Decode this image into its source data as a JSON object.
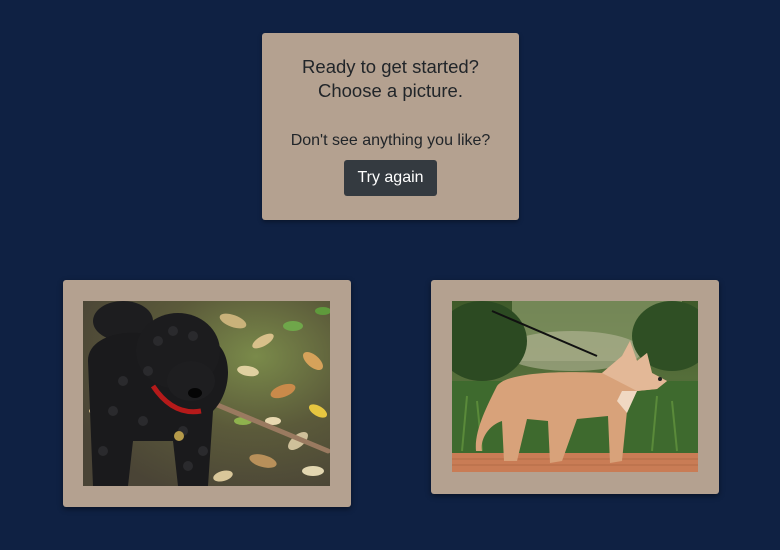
{
  "intro": {
    "headline_line1": "Ready to get started?",
    "headline_line2": "Choose a picture.",
    "subtext": "Don't see anything you like?",
    "try_again_label": "Try again"
  },
  "pictures": [
    {
      "subject": "black poodle on red leash",
      "kind": "dog-photo"
    },
    {
      "subject": "red husky on leash",
      "kind": "dog-photo"
    }
  ],
  "colors": {
    "background": "#0f2143",
    "card": "#b4a190",
    "button": "#343a40"
  }
}
